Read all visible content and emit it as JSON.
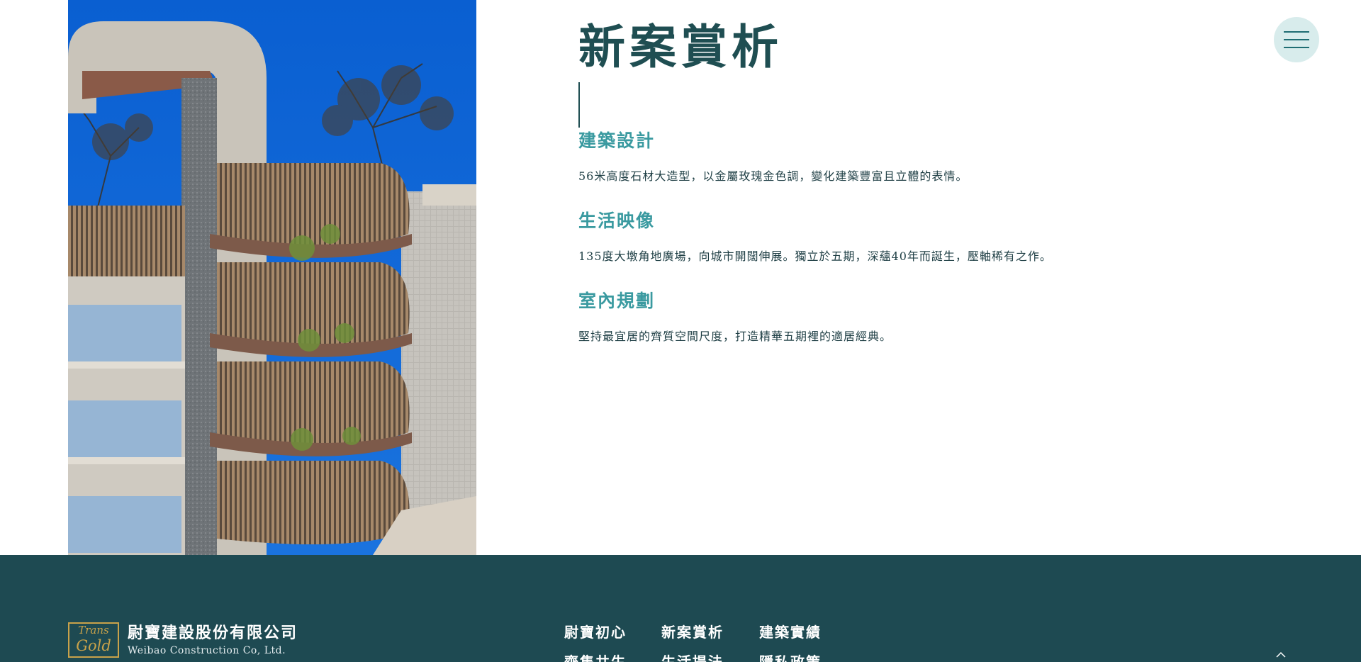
{
  "page": {
    "title": "新案賞析"
  },
  "sections": [
    {
      "title": "建築設計",
      "text": "56米高度石材大造型，以金屬玫瑰金色調，變化建築豐富且立體的表情。"
    },
    {
      "title": "生活映像",
      "text": "135度大墩角地廣場，向城市開闊伸展。獨立於五期，深蘊40年而誕生，壓軸稀有之作。"
    },
    {
      "title": "室內規劃",
      "text": "堅持最宜居的齊質空間尺度，打造精華五期裡的適居經典。"
    }
  ],
  "menu": {
    "icon": "hamburger-menu-icon"
  },
  "footer": {
    "logo": {
      "line1": "Trans",
      "line2": "Gold"
    },
    "company_name": "尉寶建設股份有限公司",
    "company_en": "Weibao Construction Co, Ltd.",
    "nav": [
      "尉寶初心",
      "新案賞析",
      "建築實績",
      "齊集共生",
      "生活提法",
      "隱私政策"
    ],
    "back_to_top_icon": "chevron-up-icon"
  },
  "colors": {
    "heading": "#1f4e52",
    "section_title": "#3a9aa0",
    "footer_bg": "#1e4a52",
    "menu_bg": "#d8ecec"
  }
}
